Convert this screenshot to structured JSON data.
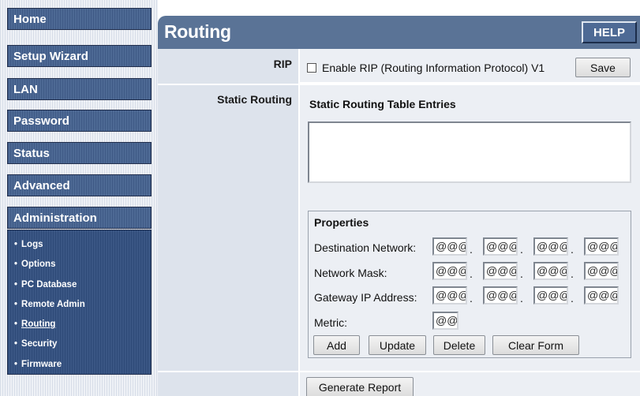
{
  "sidebar": {
    "menu": [
      {
        "label": "Home"
      },
      {
        "label": "Setup Wizard"
      },
      {
        "label": "LAN"
      },
      {
        "label": "Password"
      },
      {
        "label": "Status"
      },
      {
        "label": "Advanced"
      },
      {
        "label": "Administration"
      }
    ],
    "submenu": [
      {
        "label": "Logs"
      },
      {
        "label": "Options"
      },
      {
        "label": "PC Database"
      },
      {
        "label": "Remote Admin"
      },
      {
        "label": "Routing",
        "active": true
      },
      {
        "label": "Security"
      },
      {
        "label": "Firmware"
      }
    ],
    "bullet": "•"
  },
  "header": {
    "title": "Routing",
    "help_label": "HELP"
  },
  "rip": {
    "row_label": "RIP",
    "checkbox_label": "Enable RIP (Routing Information Protocol) V1",
    "checked": false,
    "save_label": "Save"
  },
  "static_routing": {
    "row_label": "Static Routing",
    "table_title": "Static Routing Table Entries",
    "entries": []
  },
  "properties": {
    "title": "Properties",
    "destination_label": "Destination Network:",
    "destination_octets": [
      "@@@",
      "@@@",
      "@@@",
      "@@@"
    ],
    "mask_label": "Network Mask:",
    "mask_octets": [
      "@@@",
      "@@@",
      "@@@",
      "@@@"
    ],
    "gateway_label": "Gateway IP Address:",
    "gateway_octets": [
      "@@@",
      "@@@",
      "@@@",
      "@@@"
    ],
    "metric_label": "Metric:",
    "metric_value": "@@@",
    "dot": ".",
    "buttons": {
      "add": "Add",
      "update": "Update",
      "delete": "Delete",
      "clear": "Clear Form"
    }
  },
  "footer": {
    "generate_label": "Generate Report"
  },
  "colors": {
    "header_bg": "#5a7396",
    "menu_bg": "#4d6994",
    "submenu_bg": "#3a5684",
    "label_col_bg": "#dde3ec",
    "content_bg": "#eceff4"
  }
}
